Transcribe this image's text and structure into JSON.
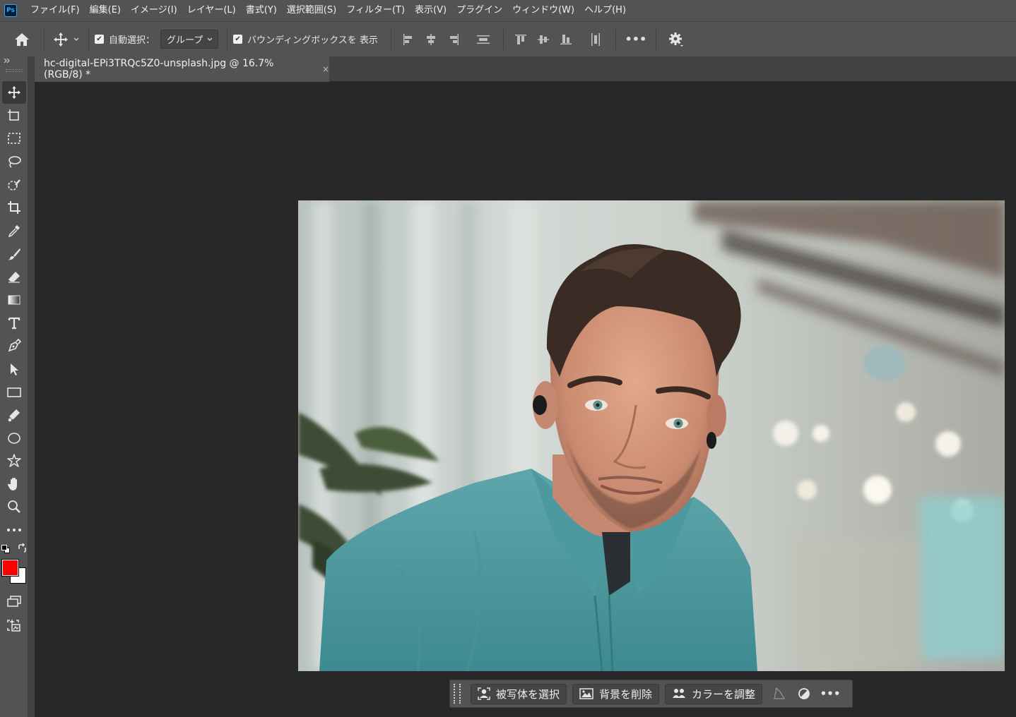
{
  "app": {
    "logo": "Ps"
  },
  "menu": [
    "ファイル(F)",
    "編集(E)",
    "イメージ(I)",
    "レイヤー(L)",
    "書式(Y)",
    "選択範囲(S)",
    "フィルター(T)",
    "表示(V)",
    "プラグイン",
    "ウィンドウ(W)",
    "ヘルプ(H)"
  ],
  "options": {
    "auto_select_label": "自動選択：",
    "auto_select_value": "グループ",
    "bounding_box_label": "バウンディングボックスを 表示",
    "more": "•••"
  },
  "document": {
    "tab_title": "hc-digital-EPi3TRQc5Z0-unsplash.jpg @ 16.7% (RGB/8) *",
    "close": "×"
  },
  "colors": {
    "foreground": "#ff0000",
    "background": "#ffffff"
  },
  "tools": [
    "move-icon",
    "artboard-icon",
    "marquee-icon",
    "lasso-icon",
    "quick-select-icon",
    "crop-icon",
    "eyedropper-icon",
    "brush-icon",
    "eraser-icon",
    "gradient-icon",
    "type-icon",
    "pen-icon",
    "path-select-icon",
    "rectangle-icon",
    "paint-bucket-icon",
    "ellipse-icon",
    "custom-shape-icon",
    "hand-icon",
    "zoom-icon",
    "more-tools-icon"
  ],
  "contextbar": {
    "select_subject": "被写体を選択",
    "remove_background": "背景を削除",
    "adjust_color": "カラーを調整",
    "more": "•••"
  }
}
